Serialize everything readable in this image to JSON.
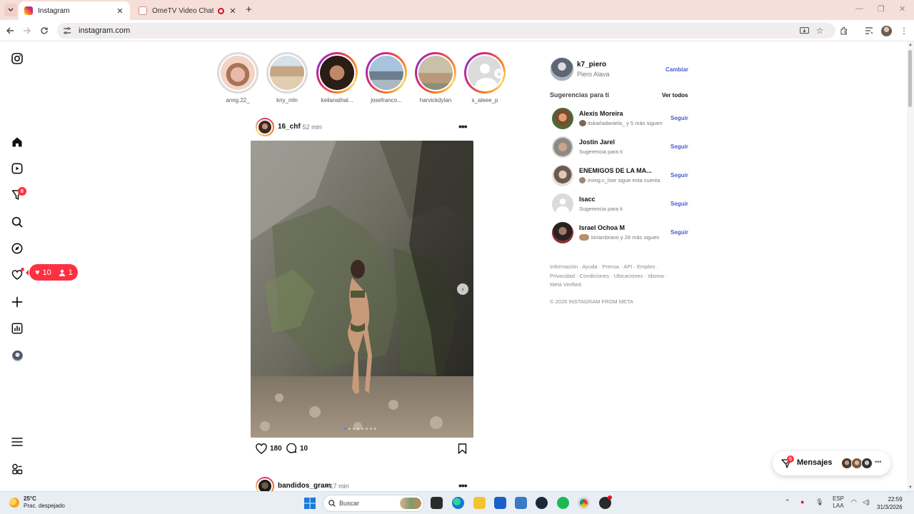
{
  "browser": {
    "tabs": [
      {
        "title": "Instagram",
        "active": true
      },
      {
        "title": "OmeTV Video Chat — Alter",
        "active": false
      }
    ],
    "url": "instagram.com"
  },
  "left_nav": {
    "items": [
      "instagram-logo-icon",
      "home-icon",
      "reels-icon",
      "explore-filter-icon",
      "search-icon",
      "compass-icon",
      "heart-icon",
      "create-icon",
      "insights-icon",
      "profile-avatar"
    ],
    "notification_badge": "8",
    "activity_pill": {
      "likes": "10",
      "followers": "1"
    }
  },
  "stories": [
    {
      "name": "anng.22_",
      "seen": true
    },
    {
      "name": "kny_mln",
      "seen": true
    },
    {
      "name": "keilanathal...",
      "seen": false
    },
    {
      "name": "josefranco...",
      "seen": false
    },
    {
      "name": "harvickdylan",
      "seen": false
    },
    {
      "name": "s_aleee_p",
      "seen": false
    }
  ],
  "post": {
    "username": "16_chf",
    "time": "• 52 min",
    "likes": "180",
    "comments": "10",
    "slide_count": 8,
    "active_slide": 1
  },
  "next_post": {
    "username": "bandidos_gram",
    "time": "• 17 min"
  },
  "account": {
    "username": "k7_piero",
    "name": "Piero Alava",
    "switch_label": "Cambiar"
  },
  "suggestions": {
    "title": "Sugerencias para ti",
    "see_all": "Ver todos",
    "follow_label": "Seguir",
    "items": [
      {
        "name": "Alexis Moreira",
        "sub": "itskarladaniela_ y 5 más siguen"
      },
      {
        "name": "Jostin Jarel",
        "sub": "Sugerencia para ti"
      },
      {
        "name": "ENEMIGOS DE LA MA...",
        "sub": "irving.c_loor sigue esta cuenta"
      },
      {
        "name": "Isacc",
        "sub": "Sugerencia para ti"
      },
      {
        "name": "Israel Ochoa M",
        "sub": "kiriambravo y 28 más siguen"
      }
    ]
  },
  "footer": {
    "links": "Información · Ayuda · Prensa · API · Empleo · Privacidad · Condiciones · Ubicaciones · Idioma · Meta Verified",
    "copyright": "© 2026 INSTAGRAM FROM META"
  },
  "messages": {
    "label": "Mensajes",
    "badge": "6"
  },
  "taskbar": {
    "weather_temp": "25°C",
    "weather_desc": "Prac. despejado",
    "search_placeholder": "Buscar",
    "lang_top": "ESP",
    "lang_bottom": "LAA",
    "time": "22:59",
    "date": "31/3/2026"
  },
  "colors": {
    "instagram_red": "#ff3040",
    "link_blue": "#4a5bd1",
    "tab_strip": "#f6dfd9"
  }
}
